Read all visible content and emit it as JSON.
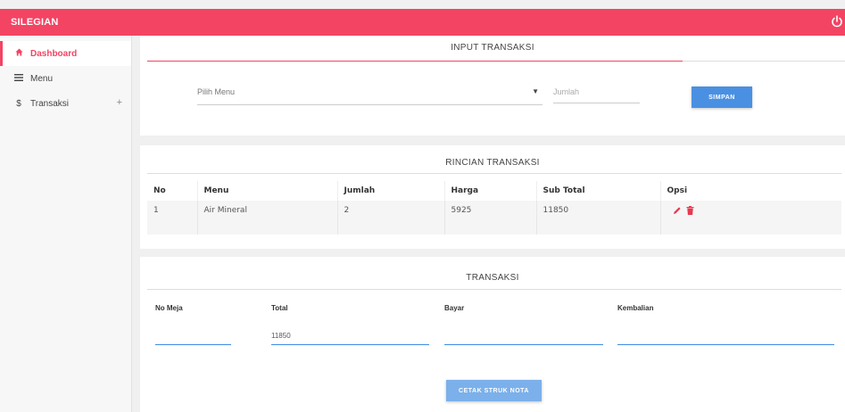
{
  "app": {
    "title": "SILEGIAN"
  },
  "sidebar": {
    "items": [
      {
        "label": "Dashboard",
        "icon": "home-icon"
      },
      {
        "label": "Menu",
        "icon": "menu-icon"
      },
      {
        "label": "Transaksi",
        "icon": "dollar-icon",
        "expand": "+"
      }
    ]
  },
  "input": {
    "title": "INPUT TRANSAKSI",
    "menu_placeholder": "Pilih Menu",
    "qty_placeholder": "Jumlah",
    "save_label": "SIMPAN"
  },
  "detail": {
    "title": "RINCIAN TRANSAKSI",
    "columns": [
      "No",
      "Menu",
      "Jumlah",
      "Harga",
      "Sub Total",
      "Opsi"
    ],
    "rows": [
      {
        "no": "1",
        "menu": "Air Mineral",
        "jumlah": "2",
        "harga": "5925",
        "subtotal": "11850"
      }
    ]
  },
  "transaksi": {
    "title": "TRANSAKSI",
    "no_meja_label": "No Meja",
    "total_label": "Total",
    "total_value": "11850",
    "bayar_label": "Bayar",
    "kembalian_label": "Kembalian",
    "print_label": "CETAK STRUK NOTA"
  },
  "colors": {
    "accent": "#f34463",
    "primary": "#4a90e2"
  }
}
